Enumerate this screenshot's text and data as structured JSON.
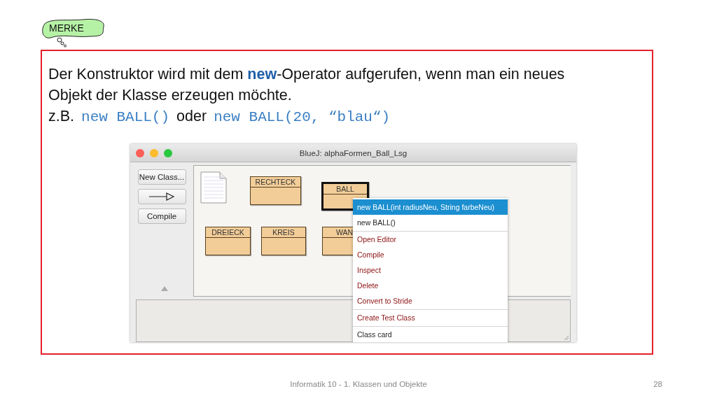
{
  "callout": {
    "text": "MERKE"
  },
  "note": {
    "paragraph": "Der Konstruktor wird mit dem **new**-Operator aufgerufen, wenn man ein neues Objekt der Klasse erzeugen möchte.",
    "example": [
      {
        "kind": "text",
        "text": "z.B."
      },
      {
        "kind": "code",
        "text": "new BALL()"
      },
      {
        "kind": "text",
        "text": "oder"
      },
      {
        "kind": "code",
        "text": "new BALL(20, “blau“)"
      }
    ]
  },
  "window": {
    "title": "BlueJ:  alphaFormen_Ball_Lsg",
    "buttons": [
      {
        "kind": "text",
        "label": "New Class..."
      },
      {
        "kind": "arrow"
      },
      {
        "kind": "text",
        "label": "Compile"
      }
    ],
    "classes": [
      {
        "name": "RECHTECK",
        "selected": false
      },
      {
        "name": "BALL",
        "selected": true
      },
      {
        "name": "DREIECK",
        "selected": false
      },
      {
        "name": "KREIS",
        "selected": false
      },
      {
        "name": "WAN",
        "selected": false
      }
    ],
    "context_menu": [
      [
        {
          "label": "new BALL(int radiusNeu, String farbeNeu)",
          "kind": "constructor",
          "selected": true
        },
        {
          "label": "new BALL()",
          "kind": "constructor",
          "selected": false
        }
      ],
      [
        {
          "label": "Open Editor",
          "kind": "command",
          "selected": false
        },
        {
          "label": "Compile",
          "kind": "command",
          "selected": false
        },
        {
          "label": "Inspect",
          "kind": "command",
          "selected": false
        },
        {
          "label": "Delete",
          "kind": "command",
          "selected": false
        },
        {
          "label": "Convert to Stride",
          "kind": "command",
          "selected": false
        }
      ],
      [
        {
          "label": "Create Test Class",
          "kind": "command",
          "selected": false
        }
      ],
      [
        {
          "label": "Class card",
          "kind": "info",
          "selected": false
        }
      ]
    ]
  },
  "footer": {
    "text": "Informatik 10 - 1. Klassen und Objekte",
    "page": "28"
  }
}
